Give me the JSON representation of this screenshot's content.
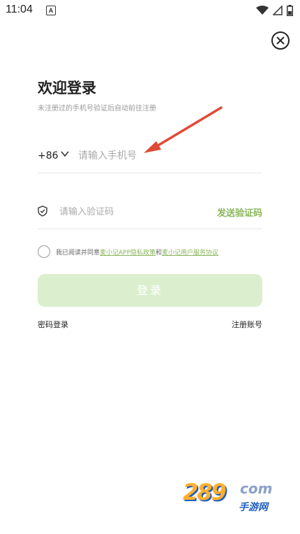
{
  "status_bar": {
    "time": "11:04",
    "notification_letter": "A",
    "icons": [
      "wifi-icon",
      "signal-icon",
      "battery-icon"
    ]
  },
  "header": {
    "close_icon": "close-icon"
  },
  "main": {
    "title": "欢迎登录",
    "subtitle": "未注册过的手机号验证后自动前往注册",
    "phone": {
      "country_code": "+86",
      "placeholder": "请输入手机号",
      "value": ""
    },
    "code": {
      "placeholder": "请输入验证码",
      "value": "",
      "send_label": "发送验证码"
    },
    "agreement": {
      "prefix": "我已阅读并同意",
      "link1": "麦小记APP隐私政策",
      "middle": "和",
      "link2": "麦小记用户服务协议"
    },
    "login_label": "登录",
    "password_login_label": "密码登录",
    "register_label": "注册账号"
  },
  "watermark": {
    "number": "289",
    "domain": "com",
    "chinese": "手游网"
  },
  "colors": {
    "accent": "#8ab65b",
    "login_button_bg": "#dbefcf",
    "arrow": "#e04a35"
  }
}
